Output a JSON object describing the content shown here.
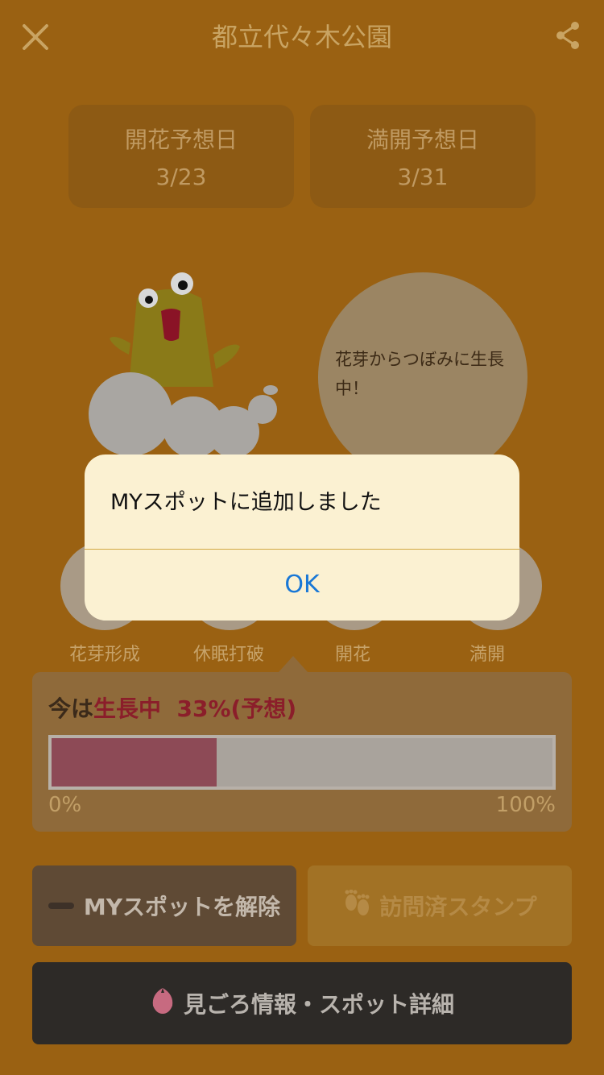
{
  "header": {
    "title": "都立代々木公園",
    "close_icon": "close-icon",
    "share_icon": "share-icon"
  },
  "forecast": {
    "bloom_label": "開花予想日",
    "bloom_date": "3/23",
    "full_label": "満開予想日",
    "full_date": "3/31"
  },
  "mascot": {
    "message": "花芽からつぼみに生長中！"
  },
  "stages": {
    "items": [
      {
        "label": "花芽形成"
      },
      {
        "label": "休眠打破"
      },
      {
        "label": "開花"
      },
      {
        "label": "満開"
      }
    ]
  },
  "progress": {
    "prefix": "今は",
    "status": "生長中",
    "percent_text": "33%(予想)",
    "percent_value": 33,
    "min_label": "0%",
    "max_label": "100%"
  },
  "actions": {
    "remove_label": "MYスポットを解除",
    "stamp_label": "訪問済スタンプ",
    "detail_label": "見ごろ情報・スポット詳細"
  },
  "alert": {
    "message": "MYスポットに追加しました",
    "ok_label": "OK"
  },
  "colors": {
    "background": "#9a6112",
    "progress_fill": "#8d4a56",
    "alert_button": "#1877d6",
    "highlight": "#8b1e2a"
  }
}
